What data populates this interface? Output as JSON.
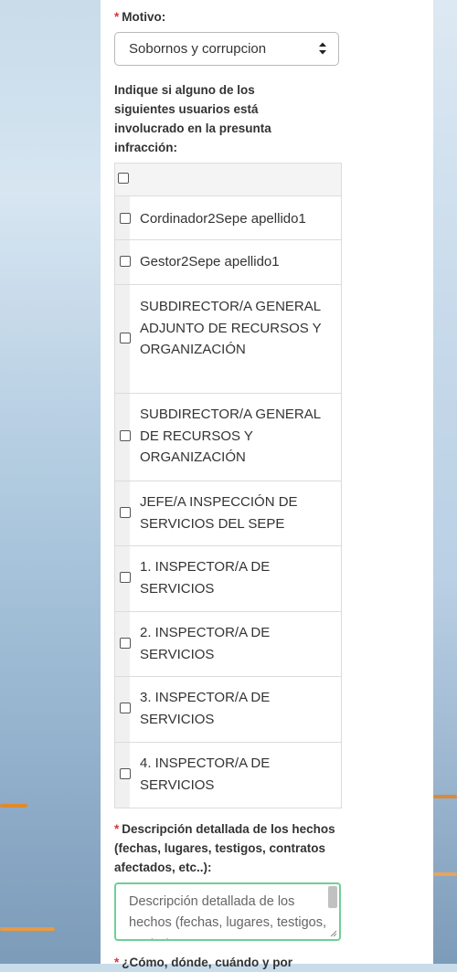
{
  "form": {
    "required_mark": "*",
    "motivo_label": "Motivo:",
    "motivo_value": "Sobornos y corrupcion",
    "users_question": "Indique si alguno de los siguientes usuarios está involucrado en la presunta infracción:",
    "users": [
      {
        "label": "Cordinador2Sepe apellido1",
        "checked": false
      },
      {
        "label": "Gestor2Sepe apellido1",
        "checked": false
      },
      {
        "label": "SUBDIRECTOR/A GENERAL ADJUNTO DE RECURSOS Y ORGANIZACIÓN",
        "checked": false
      },
      {
        "label": "SUBDIRECTOR/A GENERAL DE RECURSOS Y ORGANIZACIÓN",
        "checked": false
      },
      {
        "label": "JEFE/A INSPECCIÓN DE SERVICIOS DEL SEPE",
        "checked": false
      },
      {
        "label": "1. INSPECTOR/A DE SERVICIOS",
        "checked": false
      },
      {
        "label": "2. INSPECTOR/A DE SERVICIOS",
        "checked": false
      },
      {
        "label": "3. INSPECTOR/A DE SERVICIOS",
        "checked": false
      },
      {
        "label": "4. INSPECTOR/A DE SERVICIOS",
        "checked": false
      }
    ],
    "descripcion_label": "Descripción detallada de los hechos (fechas, lugares, testigos, contratos afectados, etc..):",
    "descripcion_placeholder": "Descripción detallada de los hechos (fechas, lugares, testigos, contratos",
    "next_label": "¿Cómo, dónde, cuándo y por"
  },
  "colors": {
    "required": "#d9343b",
    "focus_border": "#6fcf97"
  }
}
